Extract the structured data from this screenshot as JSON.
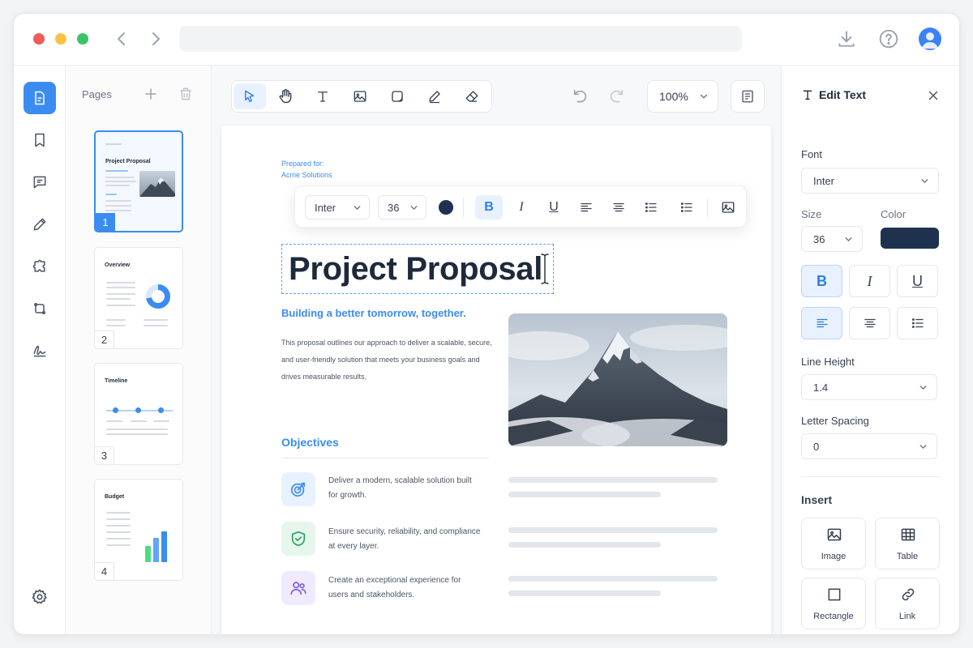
{
  "colors": {
    "accent": "#3b8cf0",
    "close_dot": "#ef5b5b",
    "minimize_dot": "#f5c542",
    "maximize_dot": "#3cc26a",
    "text_color_swatch": "#1e3250",
    "icon_target_bg": "#e8f1ff",
    "icon_shield_bg": "#e6f6ec",
    "icon_users_bg": "#efeafd"
  },
  "titlebar": {
    "icons": [
      "download-icon",
      "help-icon",
      "user-avatar"
    ]
  },
  "rail": {
    "items": [
      "pages-icon",
      "bookmark-icon",
      "comment-icon",
      "pen-icon",
      "puzzle-icon",
      "crop-icon",
      "signature-icon"
    ],
    "settings": "gear-icon"
  },
  "pages": {
    "title": "Pages",
    "thumbs": [
      {
        "num": "1",
        "title": "Project Proposal"
      },
      {
        "num": "2",
        "title": "Overview"
      },
      {
        "num": "3",
        "title": "Timeline"
      },
      {
        "num": "4",
        "title": "Budget"
      }
    ]
  },
  "toolbar": {
    "tools": [
      "select-icon",
      "hand-icon",
      "text-icon",
      "image-icon",
      "shape-icon",
      "pen-icon",
      "eraser-icon"
    ],
    "zoom": "100%"
  },
  "floating_toolbar": {
    "font": "Inter",
    "size": "36",
    "bold": "B",
    "italic": "I",
    "underline": "U"
  },
  "document": {
    "prepared_label": "Prepared for:",
    "prepared_value": "Acme Solutions",
    "title": "Project Proposal",
    "subtitle": "Building a better tomorrow, together.",
    "body": "This proposal outlines our approach to deliver a scalable, secure, and user-friendly solution that meets your business goals and drives measurable results.",
    "objectives_title": "Objectives",
    "objectives": [
      {
        "icon": "target-icon",
        "text": "Deliver a modern, scalable solution built for growth."
      },
      {
        "icon": "shield-check-icon",
        "text": "Ensure security, reliability, and compliance at every layer."
      },
      {
        "icon": "users-icon",
        "text": "Create an exceptional experience for users and stakeholders."
      }
    ]
  },
  "right_panel": {
    "title": "Edit Text",
    "font_label": "Font",
    "font_value": "Inter",
    "size_label": "Size",
    "size_value": "36",
    "color_label": "Color",
    "bold": "B",
    "italic": "I",
    "underline": "U",
    "line_height_label": "Line Height",
    "line_height_value": "1.4",
    "letter_spacing_label": "Letter Spacing",
    "letter_spacing_value": "0",
    "insert_label": "Insert",
    "insert_items": [
      {
        "label": "Image",
        "icon": "image-icon"
      },
      {
        "label": "Table",
        "icon": "table-icon"
      },
      {
        "label": "Rectangle",
        "icon": "rectangle-icon"
      },
      {
        "label": "Link",
        "icon": "link-icon"
      }
    ]
  }
}
